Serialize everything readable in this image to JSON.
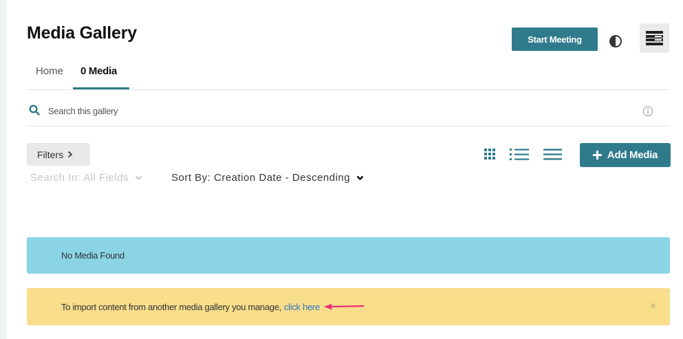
{
  "header": {
    "title": "Media Gallery",
    "start_meeting_label": "Start Meeting"
  },
  "tabs": [
    {
      "label": "Home",
      "active": false
    },
    {
      "label": "0 Media",
      "active": true
    }
  ],
  "search": {
    "placeholder": "Search this gallery",
    "value": ""
  },
  "toolbar": {
    "filters_label": "Filters",
    "add_media_label": "Add Media",
    "search_in_label": "Search In: All Fields",
    "sort_by_label": "Sort By: Creation Date - Descending"
  },
  "alerts": {
    "no_media": "No Media Found",
    "import_text": "To import content from another media gallery you manage,",
    "import_link": "click here",
    "close_symbol": "×"
  },
  "colors": {
    "accent": "#2f7b8b",
    "info_bg": "#8ad4e6",
    "warning_bg": "#f8dd8b",
    "link": "#2a75c7",
    "annotation_arrow": "#e8297a"
  },
  "icons": [
    "contrast-icon",
    "menu-icon",
    "search-icon",
    "info-icon",
    "chevron-right-icon",
    "grid-view-icon",
    "list-view-icon",
    "compact-view-icon",
    "plus-icon",
    "chevron-down-icon",
    "arrow-annotation-icon",
    "close-icon"
  ]
}
